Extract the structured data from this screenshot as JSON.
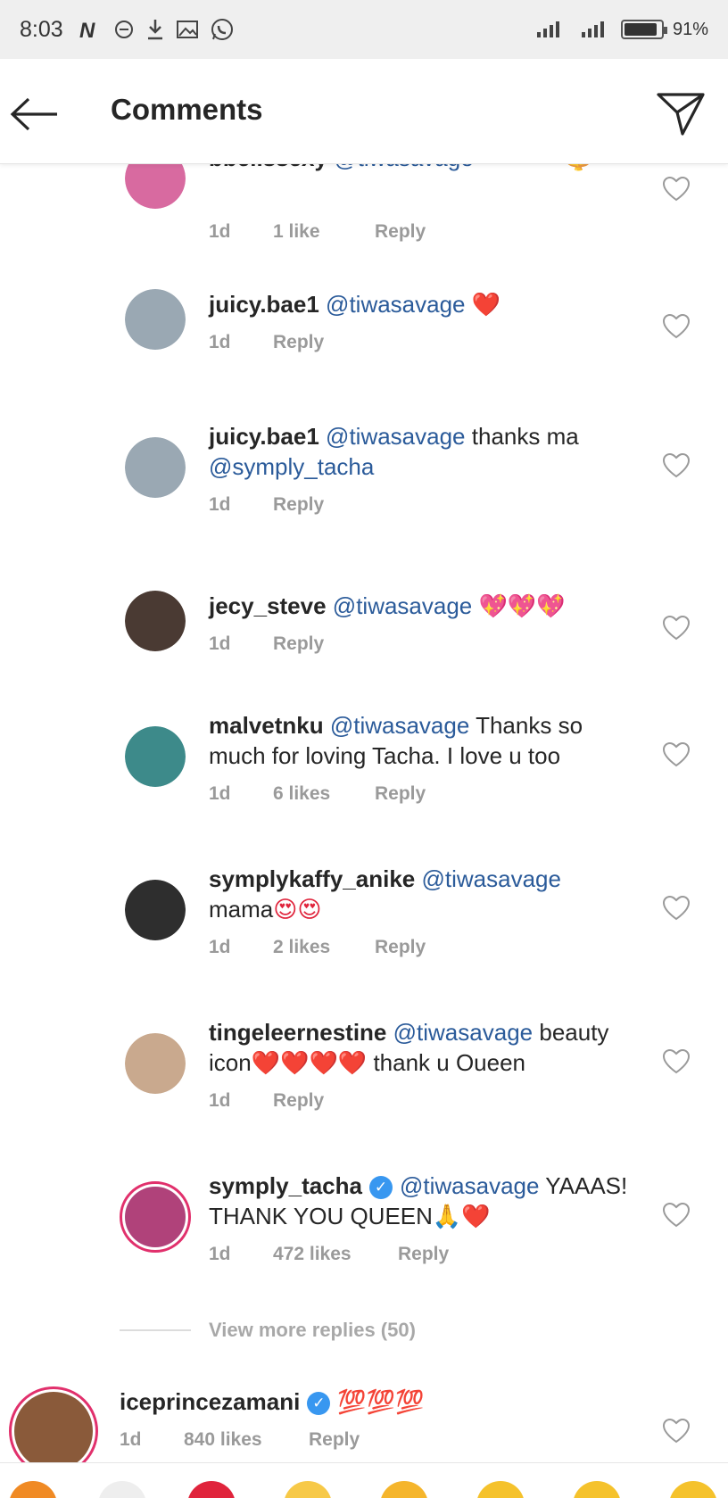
{
  "status_bar": {
    "time": "8:03",
    "battery": "91%",
    "battery_level": 0.91,
    "icons": [
      "netflix-icon",
      "circle-minus-icon",
      "download-icon",
      "gallery-icon",
      "whatsapp-icon"
    ]
  },
  "header": {
    "title": "Comments",
    "back_icon": "arrow-left-icon",
    "share_icon": "paper-plane-icon"
  },
  "comments": [
    {
      "username": "bbellssexy",
      "mention": "@tiwasavage",
      "text": "",
      "emoji": "❤❤❤❤ 🔱",
      "time": "1d",
      "likes": "1 like",
      "reply": "Reply",
      "avatar_color": "#d86aa0"
    },
    {
      "username": "juicy.bae1",
      "mention": "@tiwasavage",
      "text": "",
      "emoji": "❤️",
      "time": "1d",
      "likes": "",
      "reply": "Reply",
      "avatar_color": "#9aa8b3"
    },
    {
      "username": "juicy.bae1",
      "mention": "@tiwasavage",
      "text": "thanks ma",
      "mention2": "@symply_tacha",
      "emoji": "",
      "time": "1d",
      "likes": "",
      "reply": "Reply",
      "avatar_color": "#9aa8b3"
    },
    {
      "username": "jecy_steve",
      "mention": "@tiwasavage",
      "text": "",
      "emoji": "💖💖💖",
      "time": "1d",
      "likes": "",
      "reply": "Reply",
      "avatar_color": "#4a3a33"
    },
    {
      "username": "malvetnku",
      "mention": "@tiwasavage",
      "text": "Thanks so much for loving Tacha. I love u too",
      "emoji": "",
      "time": "1d",
      "likes": "6 likes",
      "reply": "Reply",
      "avatar_color": "#3d8a8a"
    },
    {
      "username": "symplykaffy_anike",
      "mention": "@tiwasavage",
      "text": "mama",
      "emoji": "😍😍",
      "time": "1d",
      "likes": "2 likes",
      "reply": "Reply",
      "avatar_color": "#2e2e2e"
    },
    {
      "username": "tingeleernestine",
      "mention": "@tiwasavage",
      "text": "beauty icon",
      "emoji": "❤️❤️❤️❤️",
      "text2": "thank u Oueen",
      "time": "1d",
      "likes": "",
      "reply": "Reply",
      "avatar_color": "#c9a98e"
    },
    {
      "username": "symply_tacha",
      "verified": true,
      "mention": "@tiwasavage",
      "text": "YAAAS! THANK YOU QUEEN",
      "emoji": "🙏❤️",
      "time": "1d",
      "likes": "472 likes",
      "reply": "Reply",
      "avatar_color": "#b0427a"
    }
  ],
  "view_more": "View more replies (50)",
  "top_comment": {
    "username": "iceprincezamani",
    "verified": true,
    "emoji": "💯💯💯",
    "time": "1d",
    "likes": "840 likes",
    "reply": "Reply",
    "avatar_color": "#8a5a3a"
  },
  "colors": {
    "mention": "#2b5b9a",
    "meta": "#9a9a9a",
    "verified": "#3897f0",
    "story_ring": "#e1306c"
  }
}
